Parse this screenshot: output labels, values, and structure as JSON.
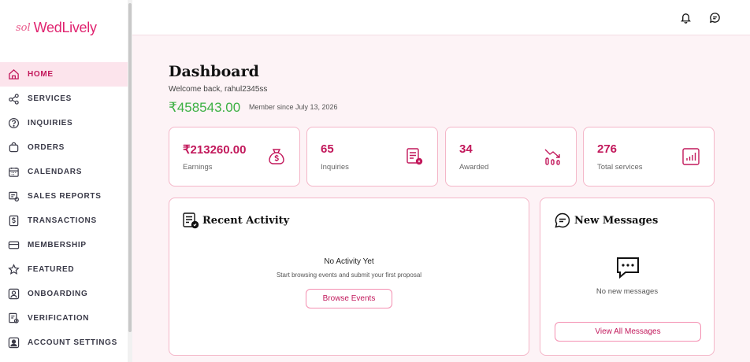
{
  "sidebar": {
    "logo_mark": "sol",
    "logo_text": "WedLively",
    "items": [
      {
        "label": "HOME",
        "icon": "home-icon"
      },
      {
        "label": "SERVICES",
        "icon": "share-icon"
      },
      {
        "label": "INQUIRIES",
        "icon": "question-icon"
      },
      {
        "label": "ORDERS",
        "icon": "bag-icon"
      },
      {
        "label": "CALENDARS",
        "icon": "calendar-icon"
      },
      {
        "label": "SALES REPORTS",
        "icon": "report-icon"
      },
      {
        "label": "TRANSACTIONS",
        "icon": "dollar-icon"
      },
      {
        "label": "MEMBERSHIP",
        "icon": "card-icon"
      },
      {
        "label": "FEATURED",
        "icon": "star-icon"
      },
      {
        "label": "ONBOARDING",
        "icon": "user-icon"
      },
      {
        "label": "VERIFICATION",
        "icon": "verify-icon"
      },
      {
        "label": "ACCOUNT SETTINGS",
        "icon": "account-icon"
      }
    ]
  },
  "header": {
    "title": "Dashboard",
    "welcome": "Welcome back, rahul2345ss",
    "balance": "₹458543.00",
    "member_since": "Member since July 13, 2026"
  },
  "stats": [
    {
      "value": "₹213260.00",
      "label": "Earnings",
      "icon": "money-bag-icon"
    },
    {
      "value": "65",
      "label": "Inquiries",
      "icon": "document-icon"
    },
    {
      "value": "34",
      "label": "Awarded",
      "icon": "trend-down-icon"
    },
    {
      "value": "276",
      "label": "Total services",
      "icon": "bar-chart-icon"
    }
  ],
  "activity": {
    "title": "Recent Activity",
    "empty_title": "No Activity Yet",
    "empty_sub": "Start browsing events and submit your first proposal",
    "button": "Browse Events"
  },
  "messages": {
    "title": "New Messages",
    "empty": "No new messages",
    "button": "View All Messages"
  },
  "colors": {
    "accent": "#c2185b",
    "brand": "#e0236f",
    "balance": "#3cb043",
    "active_bg": "#fce4ec"
  }
}
